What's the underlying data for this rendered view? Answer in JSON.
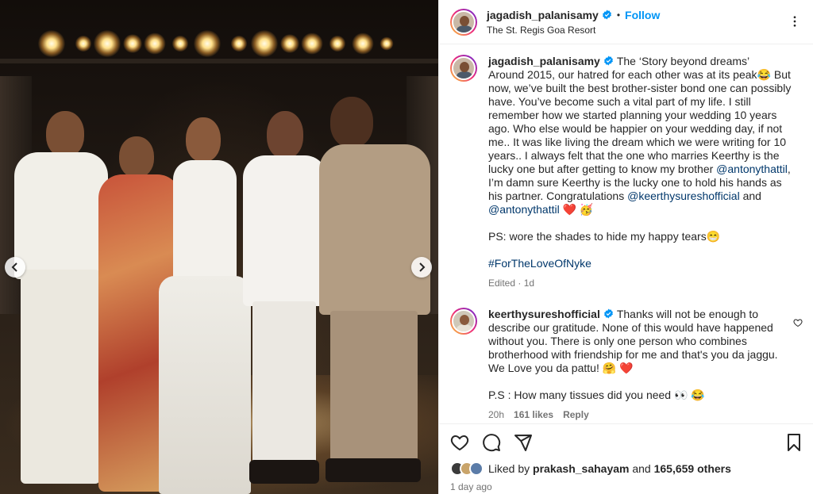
{
  "post_header": {
    "username": "jagadish_palanisamy",
    "follow_label": "Follow",
    "dot": "•",
    "location": "The St. Regis Goa Resort"
  },
  "caption": {
    "username": "jagadish_palanisamy",
    "p1_a": "The ‘Story beyond dreams’",
    "p1_b": "Around 2015, our hatred for each other was at its peak😂 But now, we’ve built the best brother-sister bond one can possibly have. You’ve become such a vital part of my life. I still remember how we started planning your wedding 10 years ago. Who else would be happier on your wedding day, if not me.. It was like living the dream which we were writing for 10 years.. I always felt that the one who marries Keerthy is the lucky one but after getting to know my brother",
    "mention1": "@antonythattil",
    "p1_c": ", I’m damn sure Keerthy is the lucky one to hold his hands as his partner. Congratulations",
    "mention2": "@keerthysureshofficial",
    "p1_d": "and",
    "mention3": "@antonythattil",
    "p1_e": "❤️ 🥳",
    "ps": "PS: wore the shades to hide my happy tears😁",
    "hashtag": "#ForTheLoveOfNyke",
    "edited": "Edited · 1d"
  },
  "reply": {
    "username": "keerthysureshofficial",
    "text": "Thanks will not be enough to describe our gratitude. None of this would have happened without you. There is only one person who combines brotherhood with friendship for me and that's you da jaggu. We Love you da pattu! 🤗 ❤️",
    "ps": "P.S : How many tissues did you need 👀 😂",
    "time": "20h",
    "likes": "161 likes",
    "reply_label": "Reply"
  },
  "likes": {
    "prefix": "Liked by",
    "user": "prakash_sahayam",
    "middle": "and",
    "count": "165,659 others"
  },
  "posted": "1 day ago",
  "colors": {
    "link": "#00376b",
    "follow": "#0095f6",
    "verified": "#0095f6",
    "heart": "#ed4956"
  },
  "icons": [
    "heart-icon",
    "comment-icon",
    "share-icon",
    "bookmark-icon",
    "more-icon",
    "verified-icon",
    "chevron-left-icon",
    "chevron-right-icon"
  ]
}
